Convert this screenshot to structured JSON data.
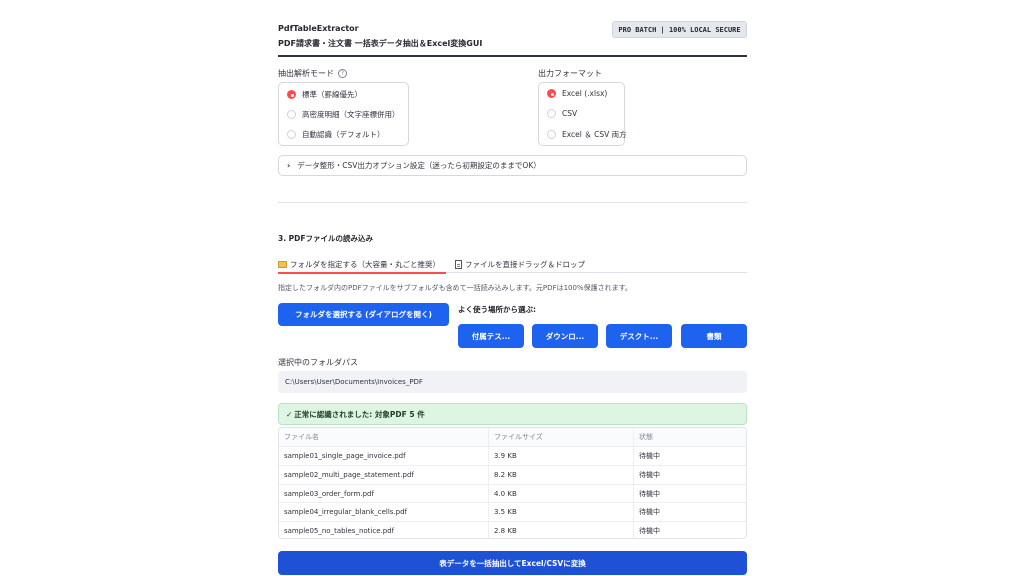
{
  "header": {
    "app_name": "PdfTableExtractor",
    "subtitle": "PDF請求書・注文書 一括表データ抽出＆Excel変換GUI",
    "badge": "PRO BATCH | 100% LOCAL SECURE"
  },
  "mode": {
    "label": "抽出解析モード",
    "help_icon": "question-circle-icon",
    "options": [
      {
        "label": "標準（罫線優先）",
        "selected": true
      },
      {
        "label": "高密度明細（文字座標併用）",
        "selected": false
      },
      {
        "label": "自動認識（デフォルト）",
        "selected": false
      }
    ]
  },
  "output_format": {
    "label": "出力フォーマット",
    "options": [
      {
        "label": "Excel (.xlsx)",
        "selected": true
      },
      {
        "label": "CSV",
        "selected": false
      },
      {
        "label": "Excel ＆ CSV 両方",
        "selected": false
      }
    ]
  },
  "expander": {
    "label": "データ整形・CSV出力オプション設定（迷ったら初期設定のままでOK）",
    "icon": "chevron-right-icon"
  },
  "section3": {
    "title": "3. PDFファイルの読み込み",
    "tabs": [
      {
        "label": "フォルダを指定する（大容量・丸ごと推奨）",
        "icon": "folder-icon",
        "active": true
      },
      {
        "label": "ファイルを直接ドラッグ＆ドロップ",
        "icon": "document-icon",
        "active": false
      }
    ],
    "caption": "指定したフォルダ内のPDFファイルをサブフォルダも含めて一括読み込みします。元PDFは100%保護されます。",
    "select_folder_button": "フォルダを選択する (ダイアログを開く)",
    "quick_label": "よく使う場所から選ぶ:",
    "quick_buttons": [
      "付属テス...",
      "ダウンロ...",
      "デスクト...",
      "書類"
    ],
    "path_label": "選択中のフォルダパス",
    "path_value": "C:\\Users\\User\\Documents\\Invoices_PDF",
    "success_message": "正常に認識されました: 対象PDF 5 件",
    "success_icon": "checkmark-icon"
  },
  "table": {
    "columns": [
      "ファイル名",
      "ファイルサイズ",
      "状態"
    ],
    "rows": [
      [
        "sample01_single_page_invoice.pdf",
        "3.9 KB",
        "待機中"
      ],
      [
        "sample02_multi_page_statement.pdf",
        "8.2 KB",
        "待機中"
      ],
      [
        "sample03_order_form.pdf",
        "4.0 KB",
        "待機中"
      ],
      [
        "sample04_irregular_blank_cells.pdf",
        "3.5 KB",
        "待機中"
      ],
      [
        "sample05_no_tables_notice.pdf",
        "2.8 KB",
        "待機中"
      ]
    ]
  },
  "primary_action": "表データを一括抽出してExcel/CSVに変換",
  "colors": {
    "accent_red": "#ff4b4b",
    "button_blue": "#1e62f0",
    "primary_blue": "#1e52d6",
    "success_bg": "#dff5e3"
  }
}
